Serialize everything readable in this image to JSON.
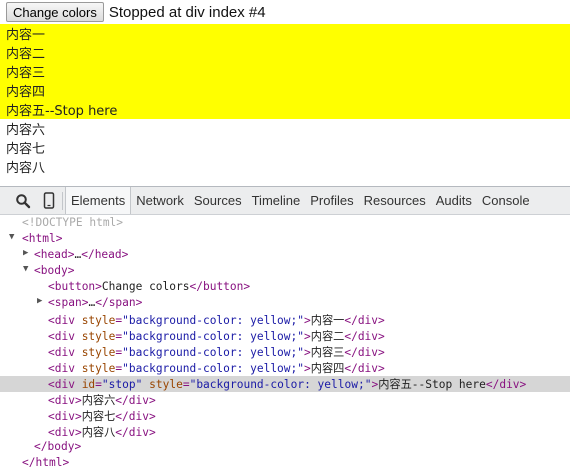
{
  "page": {
    "button_label": "Change colors",
    "status": "Stopped at div index #4",
    "rows": [
      {
        "text": "内容一",
        "highlight": true
      },
      {
        "text": "内容二",
        "highlight": true
      },
      {
        "text": "内容三",
        "highlight": true
      },
      {
        "text": "内容四",
        "highlight": true
      },
      {
        "text": "内容五--Stop here",
        "highlight": true
      },
      {
        "text": "内容六",
        "highlight": false
      },
      {
        "text": "内容七",
        "highlight": false
      },
      {
        "text": "内容八",
        "highlight": false
      }
    ],
    "highlight_color": "#ffff00"
  },
  "devtools": {
    "tools": [
      {
        "name": "search-icon"
      },
      {
        "name": "device-mode-icon"
      }
    ],
    "tabs": [
      "Elements",
      "Network",
      "Sources",
      "Timeline",
      "Profiles",
      "Resources",
      "Audits",
      "Console"
    ],
    "active_tab": "Elements",
    "dom": {
      "doctype": "<!DOCTYPE html>",
      "html_open": "html",
      "head": {
        "open": "head",
        "ellipsis": "…",
        "close": "/head"
      },
      "body_open": "body",
      "button": {
        "open": "button",
        "text": "Change colors",
        "close": "/button"
      },
      "span": {
        "open": "span",
        "ellipsis": "…",
        "close": "/span"
      },
      "styled_divs": [
        {
          "attr": "style",
          "value": "background-color: yellow;",
          "text": "内容一"
        },
        {
          "attr": "style",
          "value": "background-color: yellow;",
          "text": "内容二"
        },
        {
          "attr": "style",
          "value": "background-color: yellow;",
          "text": "内容三"
        },
        {
          "attr": "style",
          "value": "background-color: yellow;",
          "text": "内容四"
        }
      ],
      "stop_div": {
        "id_attr": "id",
        "id_value": "stop",
        "style_attr": "style",
        "style_value": "background-color: yellow;",
        "text": "内容五--Stop here"
      },
      "plain_divs": [
        "内容六",
        "内容七",
        "内容八"
      ],
      "body_close": "/body",
      "html_close": "/html"
    }
  }
}
